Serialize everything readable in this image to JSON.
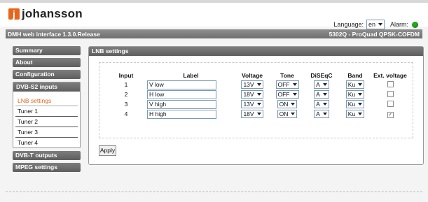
{
  "header": {
    "logo_mark": "j",
    "logo_text": "johansson",
    "language_label": "Language:",
    "language_value": "en",
    "alarm_label": "Alarm:",
    "alarm_color": "#22aa22"
  },
  "titlebar": {
    "left": "DMH web interface 1.3.0.Release",
    "right": "5302Q - ProQuad QPSK-COFDM"
  },
  "sidebar": {
    "summary": "Summary",
    "about": "About",
    "configuration": "Configuration",
    "dvbs2": "DVB-S2 inputs",
    "dvbs2_items": [
      "LNB settings",
      "Tuner 1",
      "Tuner 2",
      "Tuner 3",
      "Tuner 4"
    ],
    "dvbt": "DVB-T outputs",
    "mpeg": "MPEG settings"
  },
  "main": {
    "title": "LNB settings",
    "columns": [
      "Input",
      "Label",
      "Voltage",
      "Tone",
      "DiSEqC",
      "Band",
      "Ext. voltage"
    ],
    "rows": [
      {
        "input": "1",
        "label": "V low",
        "voltage": "13V",
        "tone": "OFF",
        "diseqc": "A",
        "band": "Ku",
        "ext": ""
      },
      {
        "input": "2",
        "label": "H low",
        "voltage": "18V",
        "tone": "OFF",
        "diseqc": "A",
        "band": "Ku",
        "ext": ""
      },
      {
        "input": "3",
        "label": "V high",
        "voltage": "13V",
        "tone": "ON",
        "diseqc": "A",
        "band": "Ku",
        "ext": ""
      },
      {
        "input": "4",
        "label": "H high",
        "voltage": "18V",
        "tone": "ON",
        "diseqc": "A",
        "band": "Ku",
        "ext": "✓"
      }
    ],
    "apply": "Apply"
  },
  "colors": {
    "accent": "#e8641a",
    "bar": "#6f6f6f"
  }
}
